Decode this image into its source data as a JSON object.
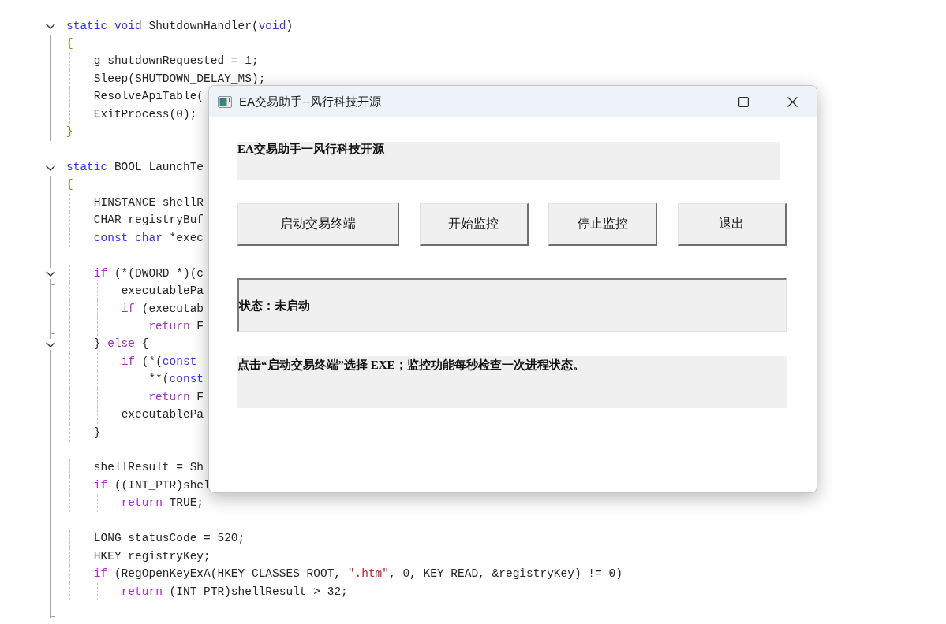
{
  "editor": {
    "lines": [
      {
        "kind": "fold",
        "expanded": true,
        "header": [
          {
            "kind": "keyword",
            "text": "static "
          },
          {
            "kind": "keyword",
            "text": "void"
          },
          {
            "kind": "text",
            "text": " ShutdownHandler("
          },
          {
            "kind": "keyword",
            "text": "void"
          },
          {
            "kind": "text",
            "text": ")"
          }
        ],
        "children": [
          {
            "kind": "line",
            "tokens": [
              {
                "kind": "brace",
                "text": "{"
              }
            ]
          },
          {
            "kind": "line",
            "tokens": [
              {
                "kind": "text",
                "text": "    g_shutdownRequested = 1;"
              }
            ]
          },
          {
            "kind": "line",
            "tokens": [
              {
                "kind": "text",
                "text": "    Sleep(SHUTDOWN_DELAY_MS);"
              }
            ]
          },
          {
            "kind": "line",
            "tokens": [
              {
                "kind": "text",
                "text": "    ResolveApiTable("
              }
            ]
          },
          {
            "kind": "line",
            "tokens": [
              {
                "kind": "text",
                "text": "    ExitProcess(0);"
              }
            ]
          },
          {
            "kind": "line",
            "tokens": [
              {
                "kind": "brace",
                "text": "}"
              }
            ]
          }
        ]
      },
      {
        "kind": "blank"
      },
      {
        "kind": "fold",
        "expanded": true,
        "header": [
          {
            "kind": "keyword",
            "text": "static"
          },
          {
            "kind": "text",
            "text": " BOOL LaunchTe"
          }
        ],
        "children": [
          {
            "kind": "line",
            "tokens": [
              {
                "kind": "brace",
                "text": "{"
              }
            ]
          },
          {
            "kind": "line",
            "tokens": [
              {
                "kind": "text",
                "text": "    HINSTANCE shellR"
              }
            ]
          },
          {
            "kind": "line",
            "tokens": [
              {
                "kind": "text",
                "text": "    CHAR registryBuf"
              }
            ]
          },
          {
            "kind": "line",
            "tokens": [
              {
                "kind": "keyword",
                "text": "    const "
              },
              {
                "kind": "keyword",
                "text": "char"
              },
              {
                "kind": "text",
                "text": " *exec"
              }
            ]
          },
          {
            "kind": "blank"
          },
          {
            "kind": "fold",
            "expanded": true,
            "header": [
              {
                "kind": "control",
                "text": "    if"
              },
              {
                "kind": "text",
                "text": " (*(DWORD *)(c"
              }
            ],
            "children": [
              {
                "kind": "line",
                "tokens": [
                  {
                    "kind": "text",
                    "text": "        executablePa"
                  }
                ]
              },
              {
                "kind": "line",
                "tokens": [
                  {
                    "kind": "control",
                    "text": "        if"
                  },
                  {
                    "kind": "text",
                    "text": " (executab"
                  }
                ]
              },
              {
                "kind": "line",
                "tokens": [
                  {
                    "kind": "control",
                    "text": "            return"
                  },
                  {
                    "kind": "text",
                    "text": " F"
                  }
                ]
              }
            ]
          },
          {
            "kind": "fold",
            "expanded": true,
            "header": [
              {
                "kind": "text",
                "text": "    } "
              },
              {
                "kind": "control",
                "text": "else"
              },
              {
                "kind": "text",
                "text": " {"
              }
            ],
            "children": [
              {
                "kind": "line",
                "tokens": [
                  {
                    "kind": "control",
                    "text": "        if"
                  },
                  {
                    "kind": "text",
                    "text": " (*("
                  },
                  {
                    "kind": "keyword",
                    "text": "const"
                  }
                ]
              },
              {
                "kind": "line",
                "tokens": [
                  {
                    "kind": "text",
                    "text": "            **("
                  },
                  {
                    "kind": "keyword",
                    "text": "const"
                  }
                ]
              },
              {
                "kind": "line",
                "tokens": [
                  {
                    "kind": "control",
                    "text": "            return"
                  },
                  {
                    "kind": "text",
                    "text": " F"
                  }
                ]
              },
              {
                "kind": "line",
                "tokens": [
                  {
                    "kind": "text",
                    "text": "        executablePa"
                  }
                ]
              },
              {
                "kind": "line",
                "tokens": [
                  {
                    "kind": "text",
                    "text": "    }"
                  }
                ]
              }
            ]
          },
          {
            "kind": "blank"
          },
          {
            "kind": "line",
            "tokens": [
              {
                "kind": "text",
                "text": "    shellResult = Sh"
              }
            ]
          },
          {
            "kind": "line",
            "tokens": [
              {
                "kind": "control",
                "text": "    if"
              },
              {
                "kind": "text",
                "text": " ((INT_PTR)shel"
              }
            ]
          },
          {
            "kind": "line",
            "tokens": [
              {
                "kind": "control",
                "text": "        return"
              },
              {
                "kind": "text",
                "text": " TRUE;"
              }
            ]
          },
          {
            "kind": "blank"
          },
          {
            "kind": "line",
            "tokens": [
              {
                "kind": "text",
                "text": "    LONG statusCode = 520;"
              }
            ]
          },
          {
            "kind": "line",
            "tokens": [
              {
                "kind": "text",
                "text": "    HKEY registryKey;"
              }
            ]
          },
          {
            "kind": "line",
            "tokens": [
              {
                "kind": "control",
                "text": "    if"
              },
              {
                "kind": "text",
                "text": " (RegOpenKeyExA(HKEY_CLASSES_ROOT, "
              },
              {
                "kind": "string",
                "text": "\".htm\""
              },
              {
                "kind": "text",
                "text": ", 0, KEY_READ, &registryKey) != 0)"
              }
            ]
          },
          {
            "kind": "line",
            "tokens": [
              {
                "kind": "control",
                "text": "        return"
              },
              {
                "kind": "text",
                "text": " (INT_PTR)shellResult > 32;"
              }
            ]
          },
          {
            "kind": "blank"
          }
        ]
      }
    ]
  },
  "dialog": {
    "title": "EA交易助手--风行科技开源",
    "heading": "EA交易助手一风行科技开源",
    "buttons": [
      "启动交易终端",
      "开始监控",
      "停止监控",
      "退出"
    ],
    "status": "状态：未启动",
    "hint": "点击“启动交易终端”选择 EXE；监控功能每秒检查一次进程状态。"
  }
}
